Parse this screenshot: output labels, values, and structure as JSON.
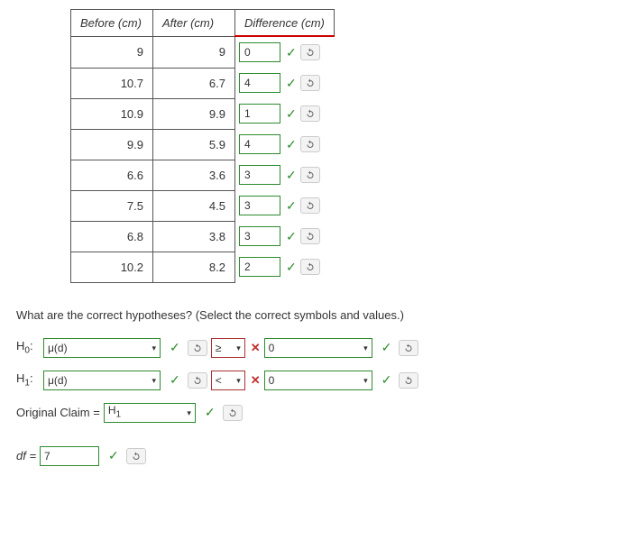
{
  "table": {
    "headers": {
      "before": "Before (cm)",
      "after": "After (cm)",
      "diff": "Difference (cm)"
    },
    "rows": [
      {
        "before": "9",
        "after": "9",
        "diff": "0"
      },
      {
        "before": "10.7",
        "after": "6.7",
        "diff": "4"
      },
      {
        "before": "10.9",
        "after": "9.9",
        "diff": "1"
      },
      {
        "before": "9.9",
        "after": "5.9",
        "diff": "4"
      },
      {
        "before": "6.6",
        "after": "3.6",
        "diff": "3"
      },
      {
        "before": "7.5",
        "after": "4.5",
        "diff": "3"
      },
      {
        "before": "6.8",
        "after": "3.8",
        "diff": "3"
      },
      {
        "before": "10.2",
        "after": "8.2",
        "diff": "2"
      }
    ]
  },
  "question": "What are the correct hypotheses? (Select the correct symbols and values.)",
  "h0": {
    "label_prefix": "H",
    "label_sub": "0",
    "param": "μ(d)",
    "op": "≥",
    "val": "0"
  },
  "h1": {
    "label_prefix": "H",
    "label_sub": "1",
    "param": "μ(d)",
    "op": "<",
    "val": "0"
  },
  "orig": {
    "label": "Original Claim =",
    "val_prefix": "H",
    "val_sub": "1"
  },
  "df": {
    "label": "df =",
    "val": "7"
  }
}
